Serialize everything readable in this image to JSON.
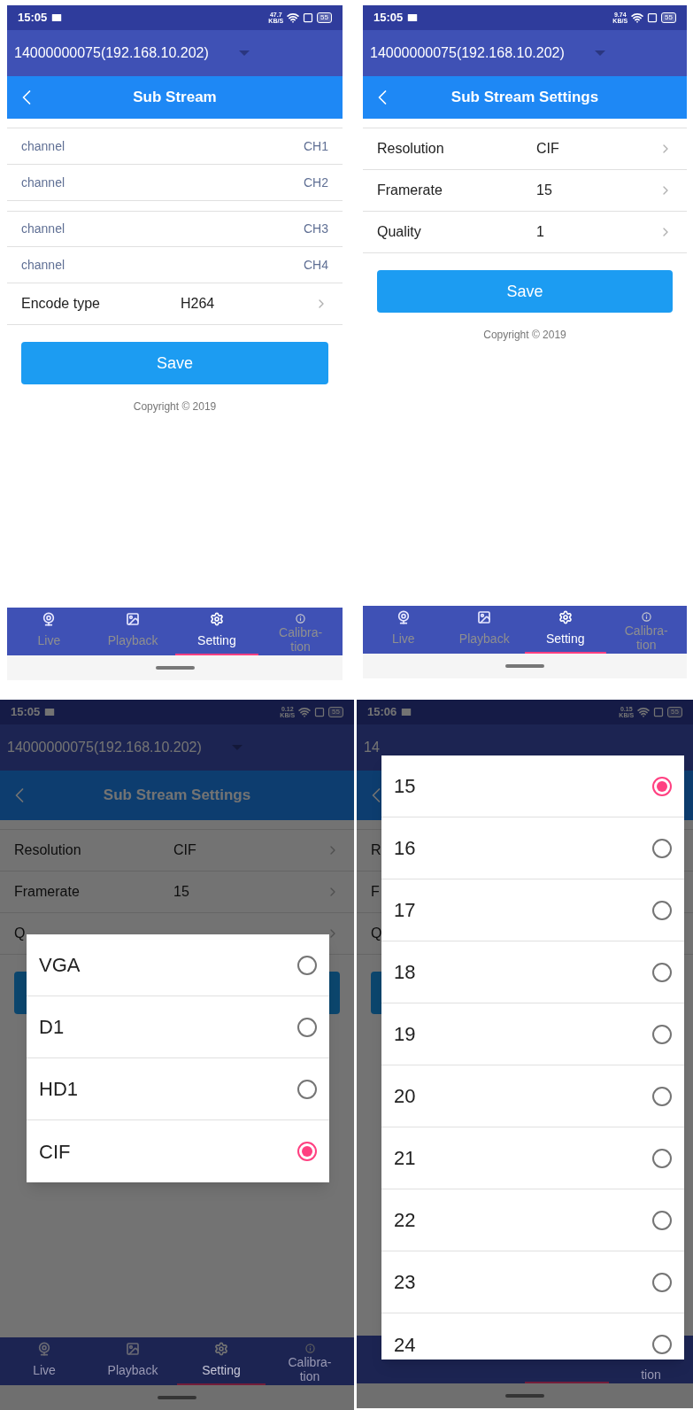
{
  "screens": [
    {
      "status": {
        "time": "15:05",
        "speed": "47.7",
        "speed_unit": "KB/S",
        "battery": "55"
      },
      "device": {
        "label": "14000000075(192.168.10.202)",
        "dropdown": true
      },
      "header": {
        "back": true,
        "title": "Sub Stream"
      },
      "dimmed": false,
      "rows": [
        {
          "kind": "channel",
          "label": "channel",
          "value": "CH1",
          "gap_before": false
        },
        {
          "kind": "channel",
          "label": "channel",
          "value": "CH2",
          "gap_before": false
        },
        {
          "kind": "channel",
          "label": "channel",
          "value": "CH3",
          "gap_before": true
        },
        {
          "kind": "channel",
          "label": "channel",
          "value": "CH4",
          "gap_before": false
        },
        {
          "kind": "setting",
          "label": "Encode type",
          "value": "H264",
          "gap_before": false
        }
      ],
      "save_button": "Save",
      "copyright": "Copyright © 2019",
      "tabs": [
        {
          "lines": [
            "Live"
          ],
          "selected": false
        },
        {
          "lines": [
            "Playback"
          ],
          "selected": false
        },
        {
          "lines": [
            "Setting"
          ],
          "selected": true
        },
        {
          "lines": [
            "Calibra-",
            "tion"
          ],
          "selected": false
        }
      ]
    },
    {
      "status": {
        "time": "15:05",
        "speed": "9.74",
        "speed_unit": "KB/S",
        "battery": "55"
      },
      "device": {
        "label": "14000000075(192.168.10.202)",
        "dropdown": true
      },
      "header": {
        "back": true,
        "title": "Sub Stream Settings"
      },
      "dimmed": false,
      "rows": [
        {
          "kind": "setting",
          "label": "Resolution",
          "value": "CIF",
          "gap_before": false
        },
        {
          "kind": "setting",
          "label": "Framerate",
          "value": "15",
          "gap_before": false
        },
        {
          "kind": "setting",
          "label": "Quality",
          "value": "1",
          "gap_before": false
        }
      ],
      "save_button": "Save",
      "copyright": "Copyright © 2019",
      "tabs": [
        {
          "lines": [
            "Live"
          ],
          "selected": false
        },
        {
          "lines": [
            "Playback"
          ],
          "selected": false
        },
        {
          "lines": [
            "Setting"
          ],
          "selected": true
        },
        {
          "lines": [
            "Calibra-",
            "tion"
          ],
          "selected": false
        }
      ]
    },
    {
      "status": {
        "time": "15:05",
        "speed": "0.12",
        "speed_unit": "KB/S",
        "battery": "55"
      },
      "device": {
        "label": "14000000075(192.168.10.202)",
        "dropdown": true
      },
      "header": {
        "back": true,
        "title": "Sub Stream Settings"
      },
      "dimmed": true,
      "rows": [
        {
          "kind": "setting",
          "label": "Resolution",
          "value": "CIF",
          "gap_before": false
        },
        {
          "kind": "setting",
          "label": "Framerate",
          "value": "15",
          "gap_before": false
        },
        {
          "kind": "setting",
          "label": "Q",
          "gap_before": false
        }
      ],
      "tabs": [
        {
          "lines": [
            "Live"
          ],
          "selected": false
        },
        {
          "lines": [
            "Playback"
          ],
          "selected": false
        },
        {
          "lines": [
            "Setting"
          ],
          "selected": true
        },
        {
          "lines": [
            "Calibra-",
            "tion"
          ],
          "selected": false
        }
      ],
      "dialog": {
        "options": [
          {
            "label": "VGA",
            "selected": false
          },
          {
            "label": "D1",
            "selected": false
          },
          {
            "label": "HD1",
            "selected": false
          },
          {
            "label": "CIF",
            "selected": true
          }
        ]
      }
    },
    {
      "status": {
        "time": "15:06",
        "speed": "0.15",
        "speed_unit": "KB/S",
        "battery": "55"
      },
      "device": {
        "label": "14",
        "dropdown": false
      },
      "header": {
        "back": true
      },
      "dimmed": true,
      "rows": [
        {
          "kind": "setting",
          "label": "R",
          "gap_before": false
        },
        {
          "kind": "setting",
          "label": "F",
          "gap_before": false
        },
        {
          "kind": "setting",
          "label": "Q",
          "gap_before": false
        }
      ],
      "tabs": [
        {
          "selected": false
        },
        {
          "selected": false
        },
        {
          "selected": true
        },
        {
          "lines": [
            "tion"
          ],
          "selected": false
        }
      ],
      "dialog": {
        "options": [
          {
            "label": "15",
            "selected": true
          },
          {
            "label": "16",
            "selected": false
          },
          {
            "label": "17",
            "selected": false
          },
          {
            "label": "18",
            "selected": false
          },
          {
            "label": "19",
            "selected": false
          },
          {
            "label": "20",
            "selected": false
          },
          {
            "label": "21",
            "selected": false
          },
          {
            "label": "22",
            "selected": false
          },
          {
            "label": "23",
            "selected": false
          },
          {
            "label": "24",
            "selected": false
          }
        ]
      }
    }
  ]
}
